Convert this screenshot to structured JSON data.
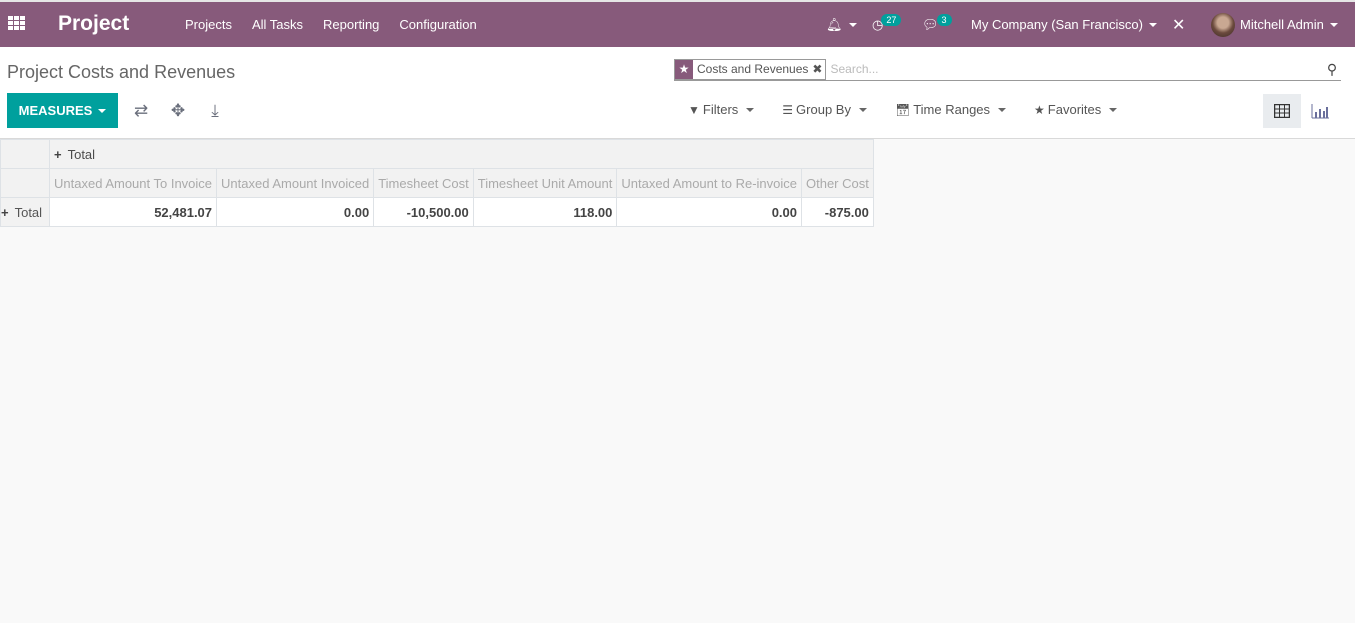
{
  "navbar": {
    "brand": "Project",
    "menu": [
      "Projects",
      "All Tasks",
      "Reporting",
      "Configuration"
    ],
    "activity_count": "27",
    "message_count": "3",
    "company": "My Company (San Francisco)",
    "user": "Mitchell Admin",
    "accent_color": "#875a7b"
  },
  "control": {
    "title": "Project Costs and Revenues",
    "measures_label": "MEASURES",
    "search": {
      "facet_label": "Costs and Revenues",
      "placeholder": "Search..."
    },
    "filters": [
      "Filters",
      "Group By",
      "Time Ranges",
      "Favorites"
    ],
    "views": [
      "pivot",
      "graph"
    ]
  },
  "pivot": {
    "col_header": "Total",
    "measures": [
      "Untaxed Amount To Invoice",
      "Untaxed Amount Invoiced",
      "Timesheet Cost",
      "Timesheet Unit Amount",
      "Untaxed Amount to Re-invoice",
      "Other Cost"
    ],
    "row_header": "Total",
    "values": [
      "52,481.07",
      "0.00",
      "-10,500.00",
      "118.00",
      "0.00",
      "-875.00"
    ]
  }
}
